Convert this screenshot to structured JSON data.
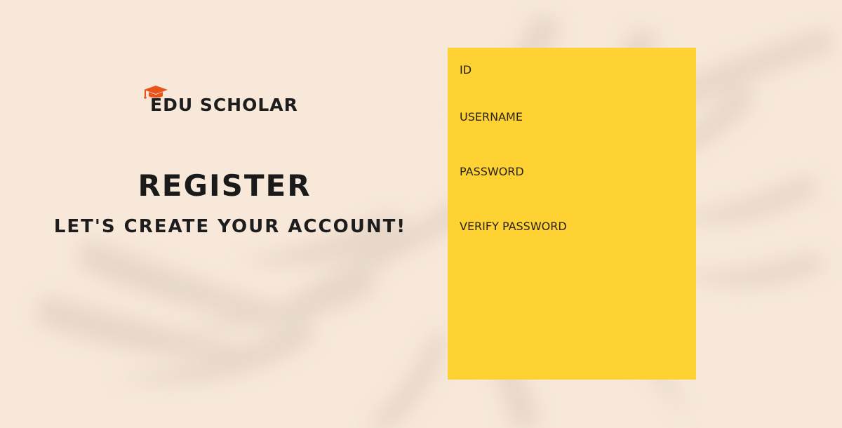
{
  "brand": {
    "name": "EDU SCHOLAR",
    "icon": "graduation-cap-icon",
    "icon_color": "#e8541a"
  },
  "hero": {
    "title": "REGISTER",
    "subtitle": "LET'S CREATE YOUR ACCOUNT!"
  },
  "form": {
    "background_color": "#ffd233",
    "fields": [
      {
        "label": "ID",
        "value": ""
      },
      {
        "label": "USERNAME",
        "value": ""
      },
      {
        "label": "PASSWORD",
        "value": ""
      },
      {
        "label": "VERIFY PASSWORD",
        "value": ""
      }
    ]
  },
  "colors": {
    "page_background": "#f7e8da",
    "text": "#1d1d1d"
  }
}
